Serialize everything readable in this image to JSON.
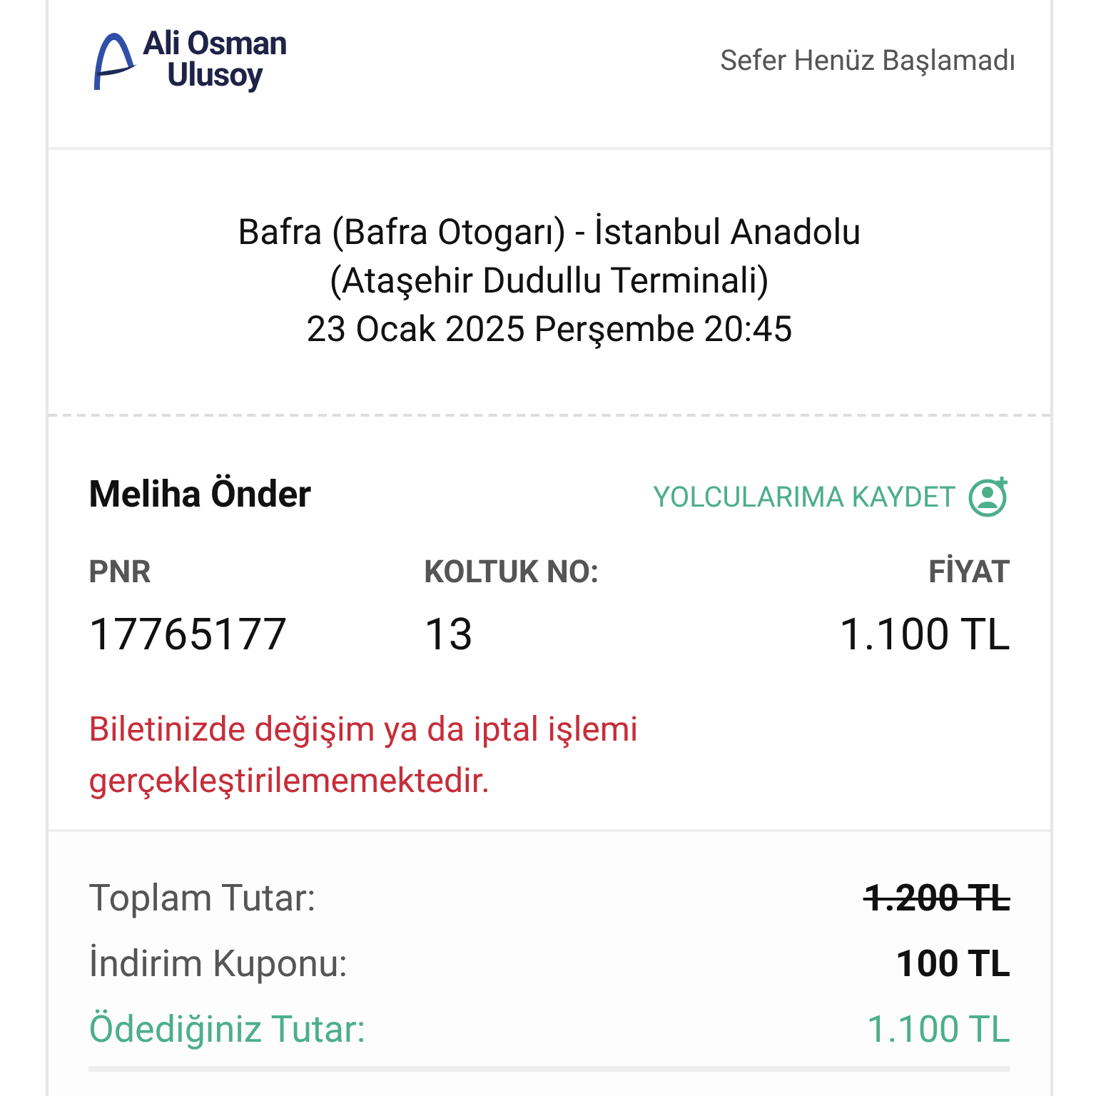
{
  "header": {
    "logo": [
      "Ali Osman",
      "Ulusoy"
    ],
    "status": "Sefer Henüz Başlamadı"
  },
  "route": {
    "lines": [
      "Bafra (Bafra Otogarı) - İstanbul Anadolu",
      "(Ataşehir Dudullu Terminali)",
      "23 Ocak 2025 Perşembe 20:45"
    ]
  },
  "passenger": {
    "name": "Meliha Önder",
    "save_link": "YOLCULARIMA KAYDET",
    "fields": [
      {
        "label": "PNR",
        "value": "17765177"
      },
      {
        "label": "KOLTUK NO:",
        "value": "13"
      },
      {
        "label": "FİYAT",
        "value": "1.100 TL"
      }
    ],
    "warning": "Biletinizde değişim ya da iptal işlemi gerçekleştirilememektedir."
  },
  "totals": [
    {
      "kind": "struck",
      "label": "Toplam Tutar:",
      "value": "1.200 TL"
    },
    {
      "kind": "normal",
      "label": "İndirim Kuponu:",
      "value": "100 TL"
    },
    {
      "kind": "paid",
      "label": "Ödediğiniz Tutar:",
      "value": "1.100 TL"
    }
  ]
}
